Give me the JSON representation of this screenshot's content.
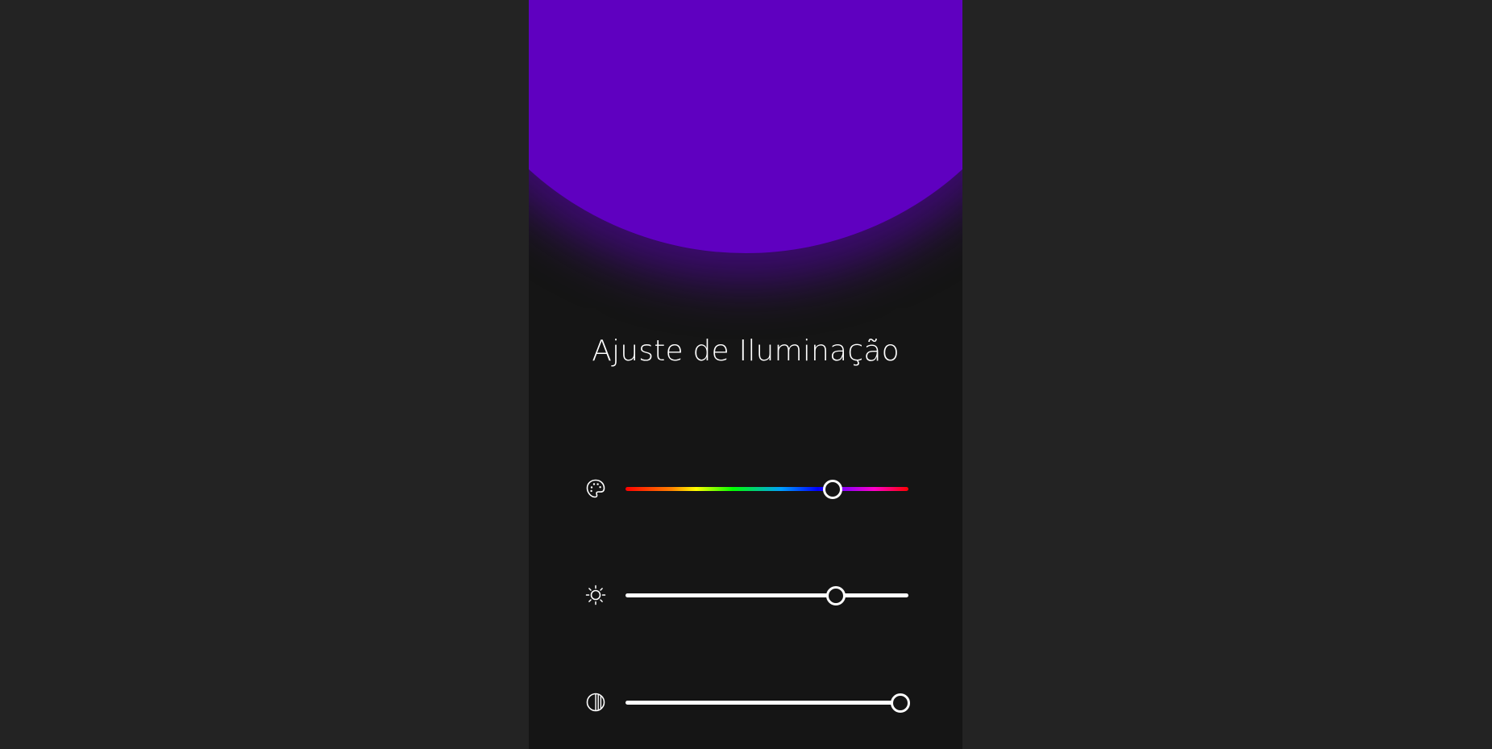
{
  "colors": {
    "page_background": "#232323",
    "panel_background": "#151515",
    "light_color": "#5f00c0"
  },
  "panel": {
    "title": "Ajuste de Iluminação"
  },
  "controls": {
    "hue": {
      "icon": "palette-icon",
      "value_fraction": 0.73
    },
    "brightness": {
      "icon": "sun-icon",
      "value_fraction": 0.74
    },
    "contrast": {
      "icon": "contrast-icon",
      "value_fraction": 0.97
    }
  }
}
